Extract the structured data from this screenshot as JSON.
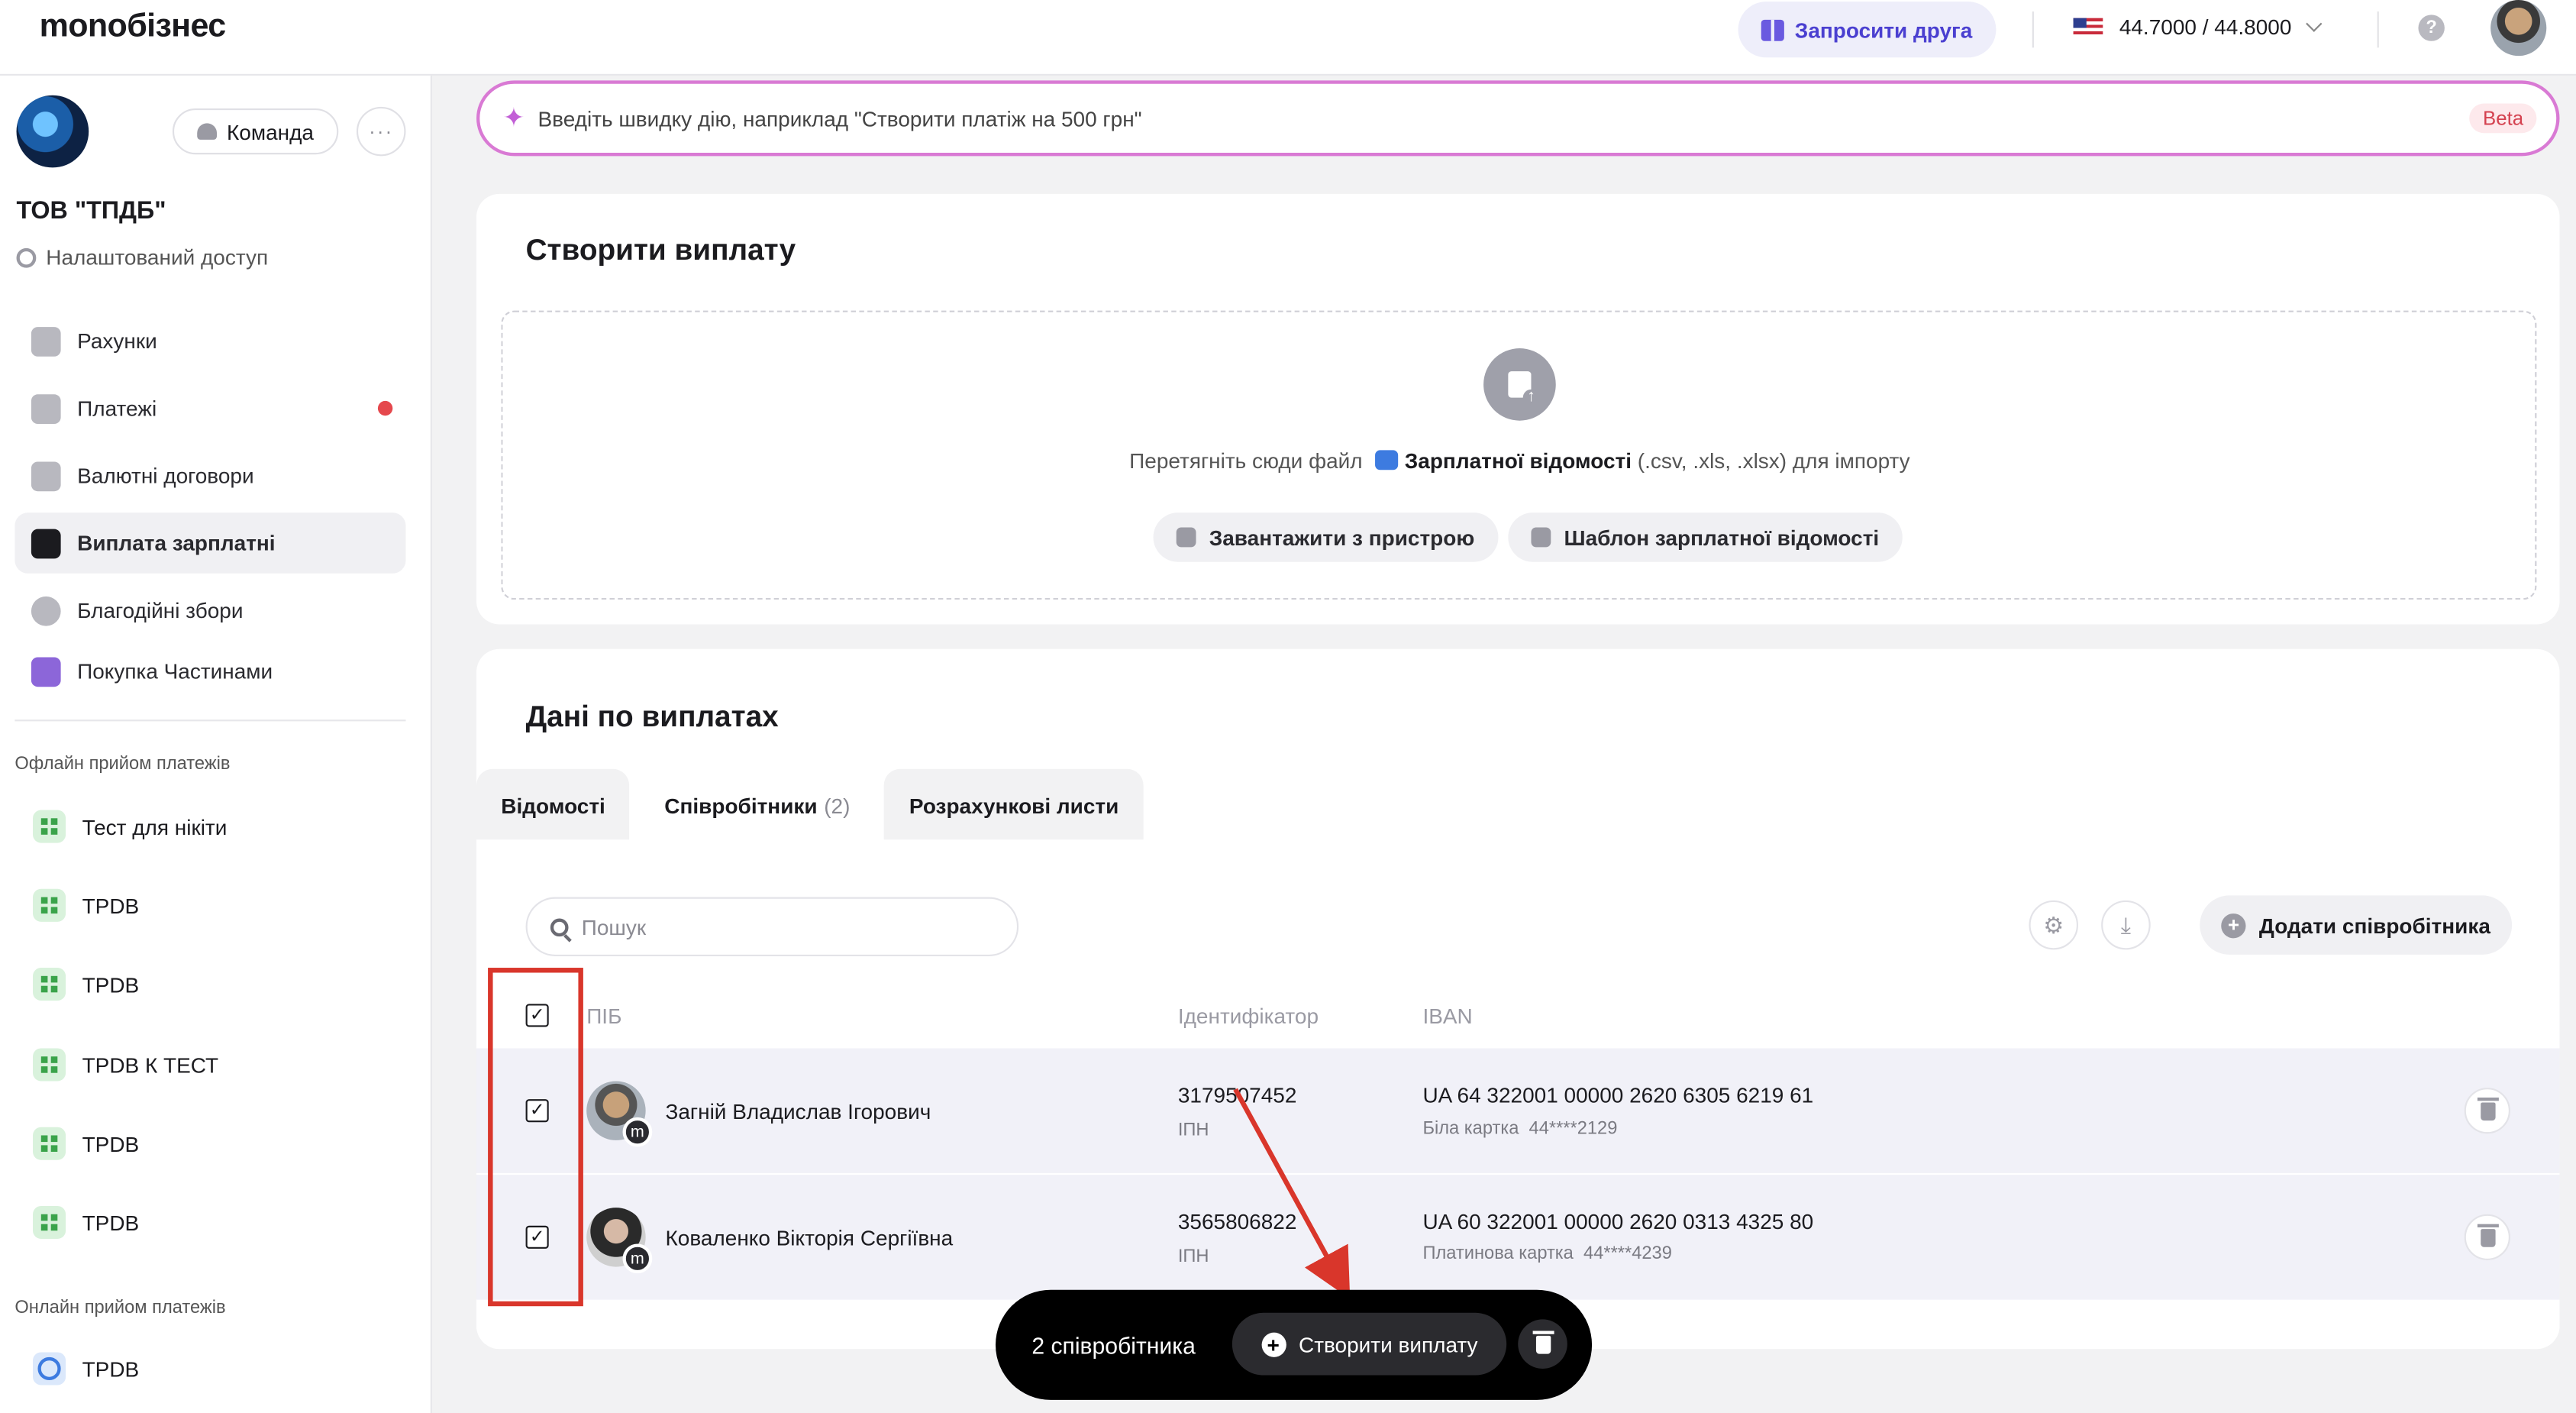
{
  "app": {
    "logo": "monoбізнес"
  },
  "header": {
    "invite_label": "Запросити друга",
    "rate": "44.7000 / 44.8000",
    "help": "?"
  },
  "sidebar": {
    "team_label": "Команда",
    "more": "···",
    "org_name": "ТОВ \"ТПДБ\"",
    "access_label": "Налаштований доступ",
    "items": [
      {
        "label": "Рахунки",
        "icon": "wallet-icon"
      },
      {
        "label": "Платежі",
        "icon": "transfer-icon"
      },
      {
        "label": "Валютні договори",
        "icon": "currency-doc-icon"
      },
      {
        "label": "Виплата зарплатні",
        "icon": "salary-icon"
      },
      {
        "label": "Благодійні збори",
        "icon": "charity-icon"
      },
      {
        "label": "Покупка Частинами",
        "icon": "paw-icon"
      }
    ],
    "offline_label": "Офлайн прийом платежів",
    "offline_items": [
      "Тест для нікіти",
      "TPDB",
      "TPDB",
      "TPDB К ТЕСТ",
      "TPDB",
      "TPDB"
    ],
    "online_label": "Онлайн прийом платежів",
    "online_items": [
      "TPDB"
    ]
  },
  "quick": {
    "placeholder": "Введіть швидку дію, наприклад \"Створити платіж на 500 грн\"",
    "beta": "Beta"
  },
  "create_card": {
    "title": "Створити виплату",
    "drop_prefix": "Перетягніть сюди файл",
    "drop_file": "Зарплатної відомості",
    "drop_suffix": "(.csv, .xls, .xlsx) для імпорту",
    "upload_label": "Завантажити з пристрою",
    "template_label": "Шаблон зарплатної відомості"
  },
  "data_card": {
    "title": "Дані по виплатах",
    "tabs": [
      {
        "label": "Відомості",
        "count": ""
      },
      {
        "label": "Співробітники",
        "count": "(2)"
      },
      {
        "label": "Розрахункові листи",
        "count": ""
      }
    ],
    "search_placeholder": "Пошук",
    "add_label": "Додати співробітника",
    "columns": {
      "name": "ПІБ",
      "id": "Ідентифікатор",
      "iban": "IBAN"
    },
    "rows": [
      {
        "name": "Загній Владислав Ігорович",
        "id": "3179507452",
        "id_type": "ІПН",
        "iban": "UA 64 322001 00000 2620 6305 6219 61",
        "card_type": "Біла картка",
        "card_mask": "44****2129",
        "badge": "m"
      },
      {
        "name": "Коваленко Вікторія Сергіївна",
        "id": "3565806822",
        "id_type": "ІПН",
        "iban": "UA 60 322001 00000 2620 0313 4325 80",
        "card_type": "Платинова картка",
        "card_mask": "44****4239",
        "badge": "m"
      }
    ]
  },
  "bottom_bar": {
    "count_label": "2 співробітника",
    "create_label": "Створити виплату"
  },
  "colors": {
    "accent": "#4a3fd0",
    "highlight_box": "#d9362b",
    "quick_border": "#d97ad4"
  }
}
